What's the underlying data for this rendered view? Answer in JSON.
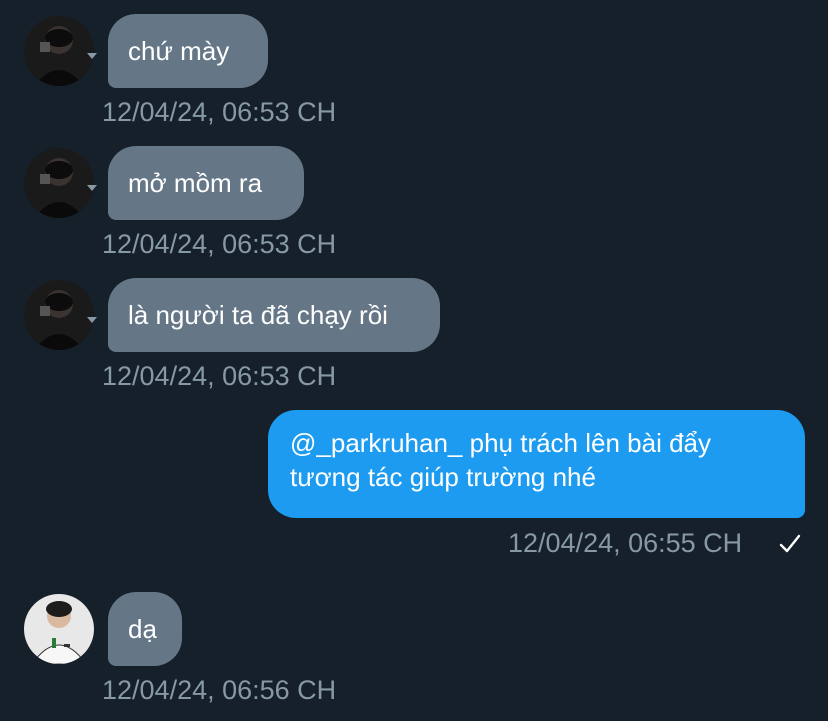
{
  "messages": [
    {
      "direction": "incoming",
      "sender": "dark-haired-avatar",
      "text": "chứ mày",
      "timestamp": "12/04/24, 06:53 CH"
    },
    {
      "direction": "incoming",
      "sender": "dark-haired-avatar",
      "text": "mở mồm ra",
      "timestamp": "12/04/24, 06:53 CH"
    },
    {
      "direction": "incoming",
      "sender": "dark-haired-avatar",
      "text": "là người ta đã chạy rồi",
      "timestamp": "12/04/24, 06:53 CH"
    },
    {
      "direction": "outgoing",
      "text_line1": "@_parkruhan_ phụ trách lên bài đẩy",
      "text_line2": "tương tác giúp trường nhé",
      "timestamp": "12/04/24, 06:55 CH",
      "status": "sent"
    },
    {
      "direction": "incoming",
      "sender": "white-shirt-avatar",
      "text": "dạ",
      "timestamp": "12/04/24, 06:56 CH"
    }
  ],
  "colors": {
    "background": "#15202b",
    "incoming_bubble": "#657786",
    "outgoing_bubble": "#1d9bf0",
    "timestamp": "#8899a6"
  },
  "icons": {
    "sent_status": "checkmark-icon",
    "avatar_menu": "chevron-down-icon"
  }
}
